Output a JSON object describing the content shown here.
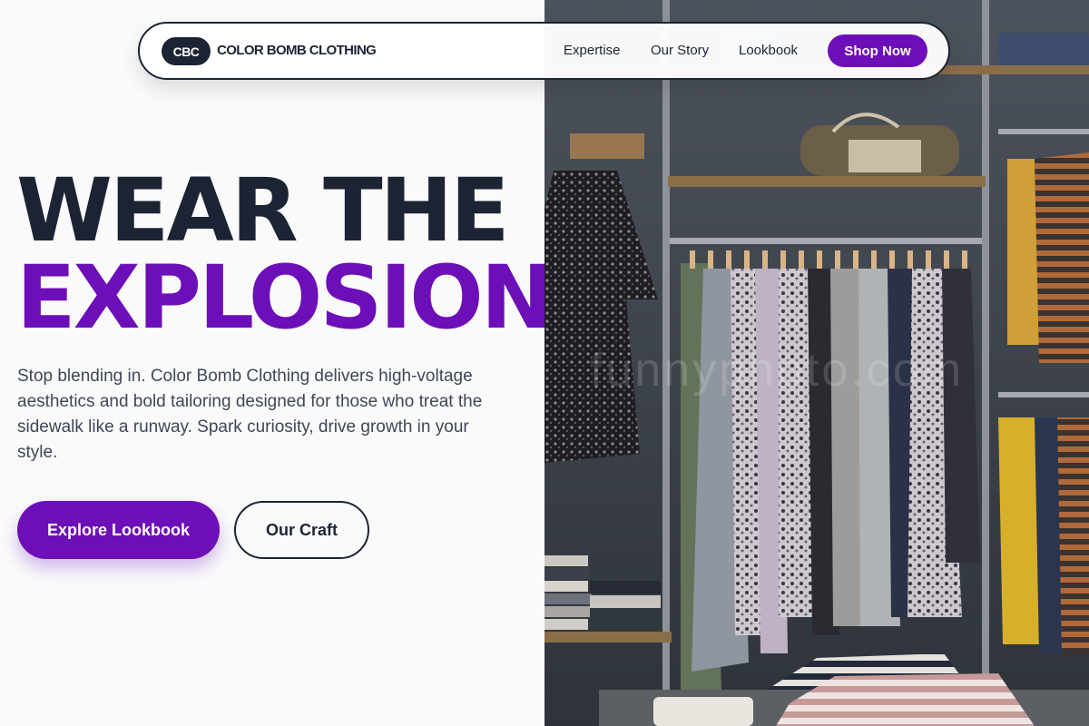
{
  "brand": {
    "badge": "CBC",
    "name": "COLOR BOMB CLOTHING"
  },
  "nav": {
    "links": [
      "Expertise",
      "Our Story",
      "Lookbook"
    ],
    "cta": "Shop Now"
  },
  "hero": {
    "title_line1": "WEAR THE",
    "title_line2": "EXPLOSION",
    "lead": "Stop blending in. Color Bomb Clothing delivers high-voltage aesthetics and bold tailoring designed for those who treat the sidewalk like a runway. Spark curiosity, drive growth in your style.",
    "primary_button": "Explore Lookbook",
    "secondary_button": "Our Craft"
  },
  "photo": {
    "watermark": "funnyphoto.com"
  },
  "colors": {
    "accent": "#6d0fb8",
    "ink": "#1c2434",
    "body_text": "#3f4756",
    "background": "#fafafb"
  }
}
